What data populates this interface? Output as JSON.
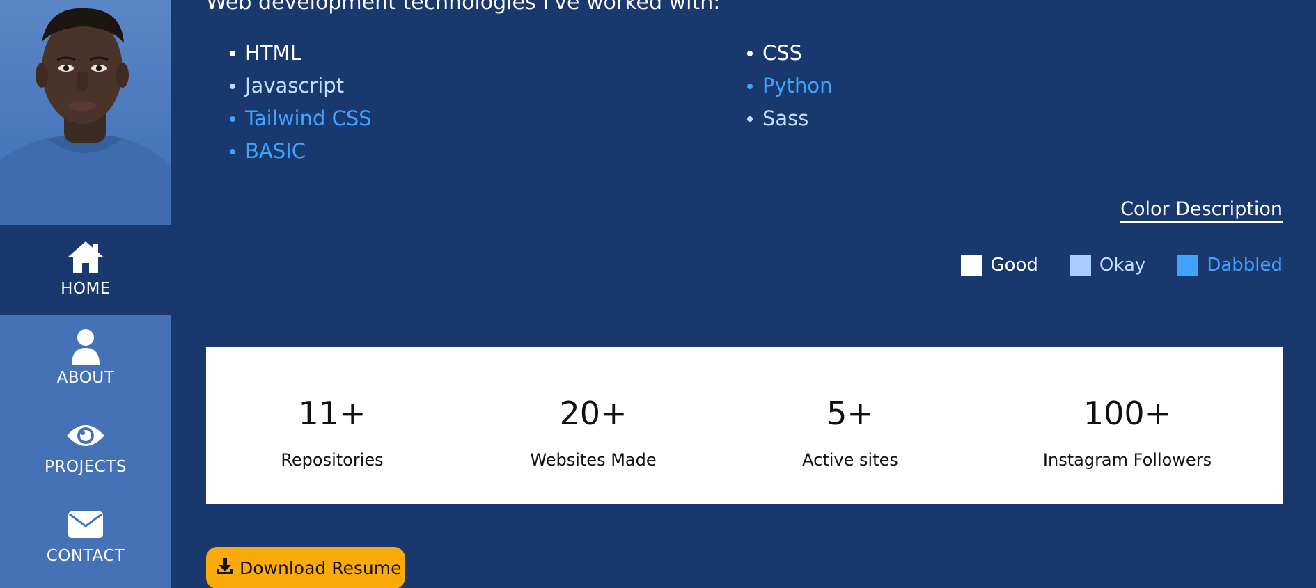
{
  "sidebar": {
    "nav": [
      {
        "label": "HOME",
        "icon": "home-icon"
      },
      {
        "label": "ABOUT",
        "icon": "user-icon"
      },
      {
        "label": "PROJECTS",
        "icon": "eye-icon"
      },
      {
        "label": "CONTACT",
        "icon": "envelope-icon"
      }
    ],
    "active": "HOME"
  },
  "main": {
    "heading": "Web development technologies I've worked with:",
    "tech_left": [
      {
        "name": "HTML",
        "level": "good"
      },
      {
        "name": "Javascript",
        "level": "okay"
      },
      {
        "name": "Tailwind CSS",
        "level": "dabbled"
      },
      {
        "name": "BASIC",
        "level": "dabbled"
      }
    ],
    "tech_right": [
      {
        "name": "CSS",
        "level": "good"
      },
      {
        "name": "Python",
        "level": "dabbled"
      },
      {
        "name": "Sass",
        "level": "okay"
      }
    ],
    "color_description": "Color Description",
    "legend": [
      {
        "label": "Good",
        "color": "#ffffff"
      },
      {
        "label": "Okay",
        "color": "#a9cdff"
      },
      {
        "label": "Dabbled",
        "color": "#3fa4ff"
      }
    ],
    "stats": [
      {
        "value": "11+",
        "label": "Repositories"
      },
      {
        "value": "20+",
        "label": "Websites Made"
      },
      {
        "value": "5+",
        "label": "Active sites"
      },
      {
        "value": "100+",
        "label": "Instagram Followers"
      }
    ],
    "download_label": "Download Resume"
  },
  "colors": {
    "page_bg": "#19386d",
    "sidebar_bg": "#4572b6",
    "button_bg": "#fbab09"
  }
}
